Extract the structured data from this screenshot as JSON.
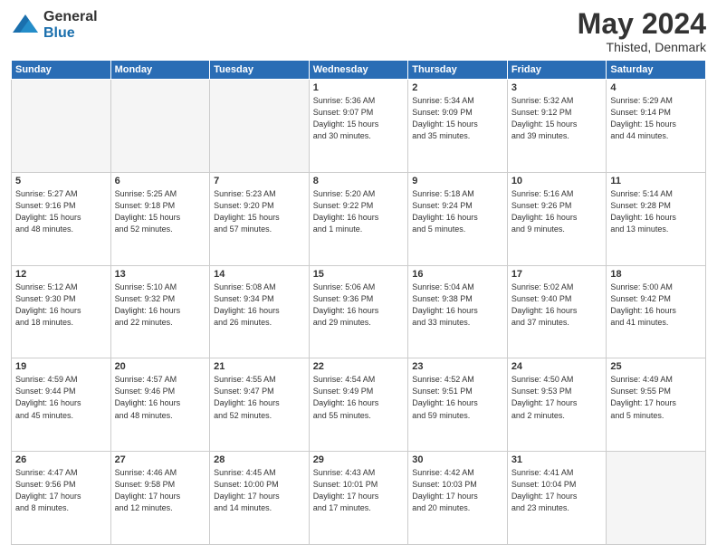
{
  "logo": {
    "general": "General",
    "blue": "Blue"
  },
  "title": {
    "month_year": "May 2024",
    "location": "Thisted, Denmark"
  },
  "weekdays": [
    "Sunday",
    "Monday",
    "Tuesday",
    "Wednesday",
    "Thursday",
    "Friday",
    "Saturday"
  ],
  "weeks": [
    [
      {
        "day": "",
        "info": ""
      },
      {
        "day": "",
        "info": ""
      },
      {
        "day": "",
        "info": ""
      },
      {
        "day": "1",
        "info": "Sunrise: 5:36 AM\nSunset: 9:07 PM\nDaylight: 15 hours\nand 30 minutes."
      },
      {
        "day": "2",
        "info": "Sunrise: 5:34 AM\nSunset: 9:09 PM\nDaylight: 15 hours\nand 35 minutes."
      },
      {
        "day": "3",
        "info": "Sunrise: 5:32 AM\nSunset: 9:12 PM\nDaylight: 15 hours\nand 39 minutes."
      },
      {
        "day": "4",
        "info": "Sunrise: 5:29 AM\nSunset: 9:14 PM\nDaylight: 15 hours\nand 44 minutes."
      }
    ],
    [
      {
        "day": "5",
        "info": "Sunrise: 5:27 AM\nSunset: 9:16 PM\nDaylight: 15 hours\nand 48 minutes."
      },
      {
        "day": "6",
        "info": "Sunrise: 5:25 AM\nSunset: 9:18 PM\nDaylight: 15 hours\nand 52 minutes."
      },
      {
        "day": "7",
        "info": "Sunrise: 5:23 AM\nSunset: 9:20 PM\nDaylight: 15 hours\nand 57 minutes."
      },
      {
        "day": "8",
        "info": "Sunrise: 5:20 AM\nSunset: 9:22 PM\nDaylight: 16 hours\nand 1 minute."
      },
      {
        "day": "9",
        "info": "Sunrise: 5:18 AM\nSunset: 9:24 PM\nDaylight: 16 hours\nand 5 minutes."
      },
      {
        "day": "10",
        "info": "Sunrise: 5:16 AM\nSunset: 9:26 PM\nDaylight: 16 hours\nand 9 minutes."
      },
      {
        "day": "11",
        "info": "Sunrise: 5:14 AM\nSunset: 9:28 PM\nDaylight: 16 hours\nand 13 minutes."
      }
    ],
    [
      {
        "day": "12",
        "info": "Sunrise: 5:12 AM\nSunset: 9:30 PM\nDaylight: 16 hours\nand 18 minutes."
      },
      {
        "day": "13",
        "info": "Sunrise: 5:10 AM\nSunset: 9:32 PM\nDaylight: 16 hours\nand 22 minutes."
      },
      {
        "day": "14",
        "info": "Sunrise: 5:08 AM\nSunset: 9:34 PM\nDaylight: 16 hours\nand 26 minutes."
      },
      {
        "day": "15",
        "info": "Sunrise: 5:06 AM\nSunset: 9:36 PM\nDaylight: 16 hours\nand 29 minutes."
      },
      {
        "day": "16",
        "info": "Sunrise: 5:04 AM\nSunset: 9:38 PM\nDaylight: 16 hours\nand 33 minutes."
      },
      {
        "day": "17",
        "info": "Sunrise: 5:02 AM\nSunset: 9:40 PM\nDaylight: 16 hours\nand 37 minutes."
      },
      {
        "day": "18",
        "info": "Sunrise: 5:00 AM\nSunset: 9:42 PM\nDaylight: 16 hours\nand 41 minutes."
      }
    ],
    [
      {
        "day": "19",
        "info": "Sunrise: 4:59 AM\nSunset: 9:44 PM\nDaylight: 16 hours\nand 45 minutes."
      },
      {
        "day": "20",
        "info": "Sunrise: 4:57 AM\nSunset: 9:46 PM\nDaylight: 16 hours\nand 48 minutes."
      },
      {
        "day": "21",
        "info": "Sunrise: 4:55 AM\nSunset: 9:47 PM\nDaylight: 16 hours\nand 52 minutes."
      },
      {
        "day": "22",
        "info": "Sunrise: 4:54 AM\nSunset: 9:49 PM\nDaylight: 16 hours\nand 55 minutes."
      },
      {
        "day": "23",
        "info": "Sunrise: 4:52 AM\nSunset: 9:51 PM\nDaylight: 16 hours\nand 59 minutes."
      },
      {
        "day": "24",
        "info": "Sunrise: 4:50 AM\nSunset: 9:53 PM\nDaylight: 17 hours\nand 2 minutes."
      },
      {
        "day": "25",
        "info": "Sunrise: 4:49 AM\nSunset: 9:55 PM\nDaylight: 17 hours\nand 5 minutes."
      }
    ],
    [
      {
        "day": "26",
        "info": "Sunrise: 4:47 AM\nSunset: 9:56 PM\nDaylight: 17 hours\nand 8 minutes."
      },
      {
        "day": "27",
        "info": "Sunrise: 4:46 AM\nSunset: 9:58 PM\nDaylight: 17 hours\nand 12 minutes."
      },
      {
        "day": "28",
        "info": "Sunrise: 4:45 AM\nSunset: 10:00 PM\nDaylight: 17 hours\nand 14 minutes."
      },
      {
        "day": "29",
        "info": "Sunrise: 4:43 AM\nSunset: 10:01 PM\nDaylight: 17 hours\nand 17 minutes."
      },
      {
        "day": "30",
        "info": "Sunrise: 4:42 AM\nSunset: 10:03 PM\nDaylight: 17 hours\nand 20 minutes."
      },
      {
        "day": "31",
        "info": "Sunrise: 4:41 AM\nSunset: 10:04 PM\nDaylight: 17 hours\nand 23 minutes."
      },
      {
        "day": "",
        "info": ""
      }
    ]
  ]
}
